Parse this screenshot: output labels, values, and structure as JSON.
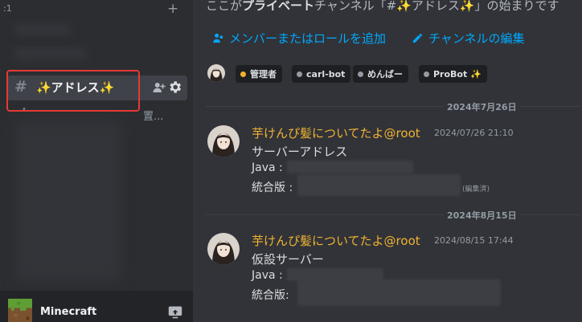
{
  "sidebar": {
    "category_label": ":1",
    "add_label": "+",
    "active_channel": {
      "hash": "#",
      "name": "✨アドレス✨"
    },
    "truncated_tail": "置...",
    "user": {
      "name": "Minecraft"
    }
  },
  "main": {
    "welcome": {
      "pre": "ここが",
      "bold": "プライベート",
      "post": "チャンネル「#✨アドレス✨」の始まりです"
    },
    "actions": {
      "add_members": "メンバーまたはロールを追加",
      "edit_channel": "チャンネルの編集"
    },
    "roles": [
      {
        "name": "管理者",
        "color": "#f0b232"
      },
      {
        "name": "carl-bot",
        "color": "#949ba4"
      },
      {
        "name": "めんばー",
        "color": "#949ba4"
      },
      {
        "name": "ProBot ✨",
        "color": "#949ba4"
      }
    ],
    "messages": [
      {
        "date_divider": "2024年7月26日",
        "author": "芋けんぴ髪についてたよ@root",
        "timestamp": "2024/07/26 21:10",
        "title": "サーバーアドレス",
        "java_label": "Java :",
        "bedrock_label": "統合版 :",
        "edited": "(編集済)"
      },
      {
        "date_divider": "2024年8月15日",
        "author": "芋けんぴ髪についてたよ@root",
        "timestamp": "2024/08/15 17:44",
        "title": "仮設サーバー",
        "java_label": "Java :",
        "bedrock_label": "統合版:"
      }
    ]
  },
  "colors": {
    "accent_link": "#00a8fc",
    "author": "#f0b232",
    "highlight_box": "#e53935"
  },
  "icons": [
    "add-member-icon",
    "gear-icon",
    "pencil-icon",
    "share-screen-icon",
    "minecraft-grass-icon"
  ]
}
